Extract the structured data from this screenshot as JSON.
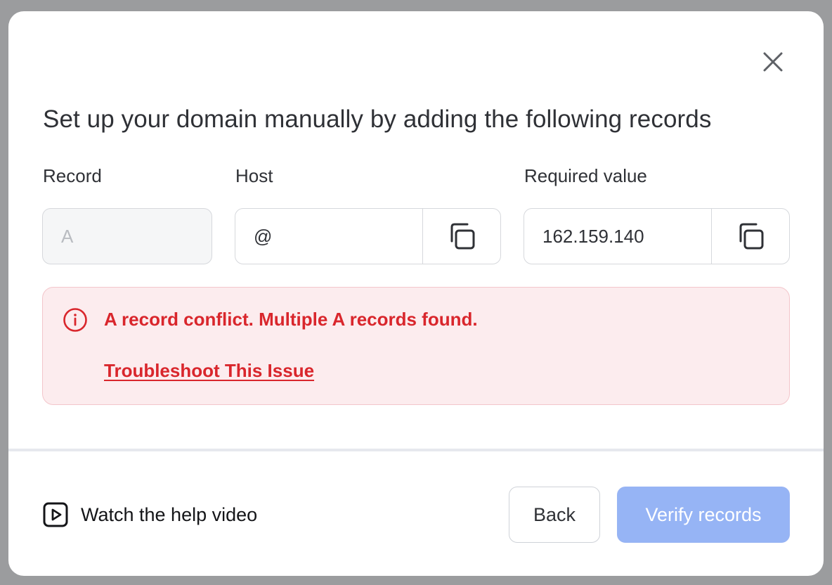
{
  "dialog": {
    "title": "Set up your domain manually by adding the following records",
    "close_icon": "close-icon"
  },
  "columns": {
    "record_label": "Record",
    "host_label": "Host",
    "value_label": "Required value"
  },
  "fields": {
    "record_value": "A",
    "host_value": "@",
    "required_value": "162.159.140",
    "copy_icon": "copy-icon"
  },
  "alert": {
    "message": "A record conflict. Multiple A records found.",
    "link": "Troubleshoot This Issue",
    "icon": "info-icon",
    "color": "#d9262c",
    "background": "#fcecee"
  },
  "footer": {
    "help_label": "Watch the help video",
    "help_icon": "play-video-icon",
    "back_label": "Back",
    "verify_label": "Verify records",
    "verify_color": "#96b4f5"
  }
}
